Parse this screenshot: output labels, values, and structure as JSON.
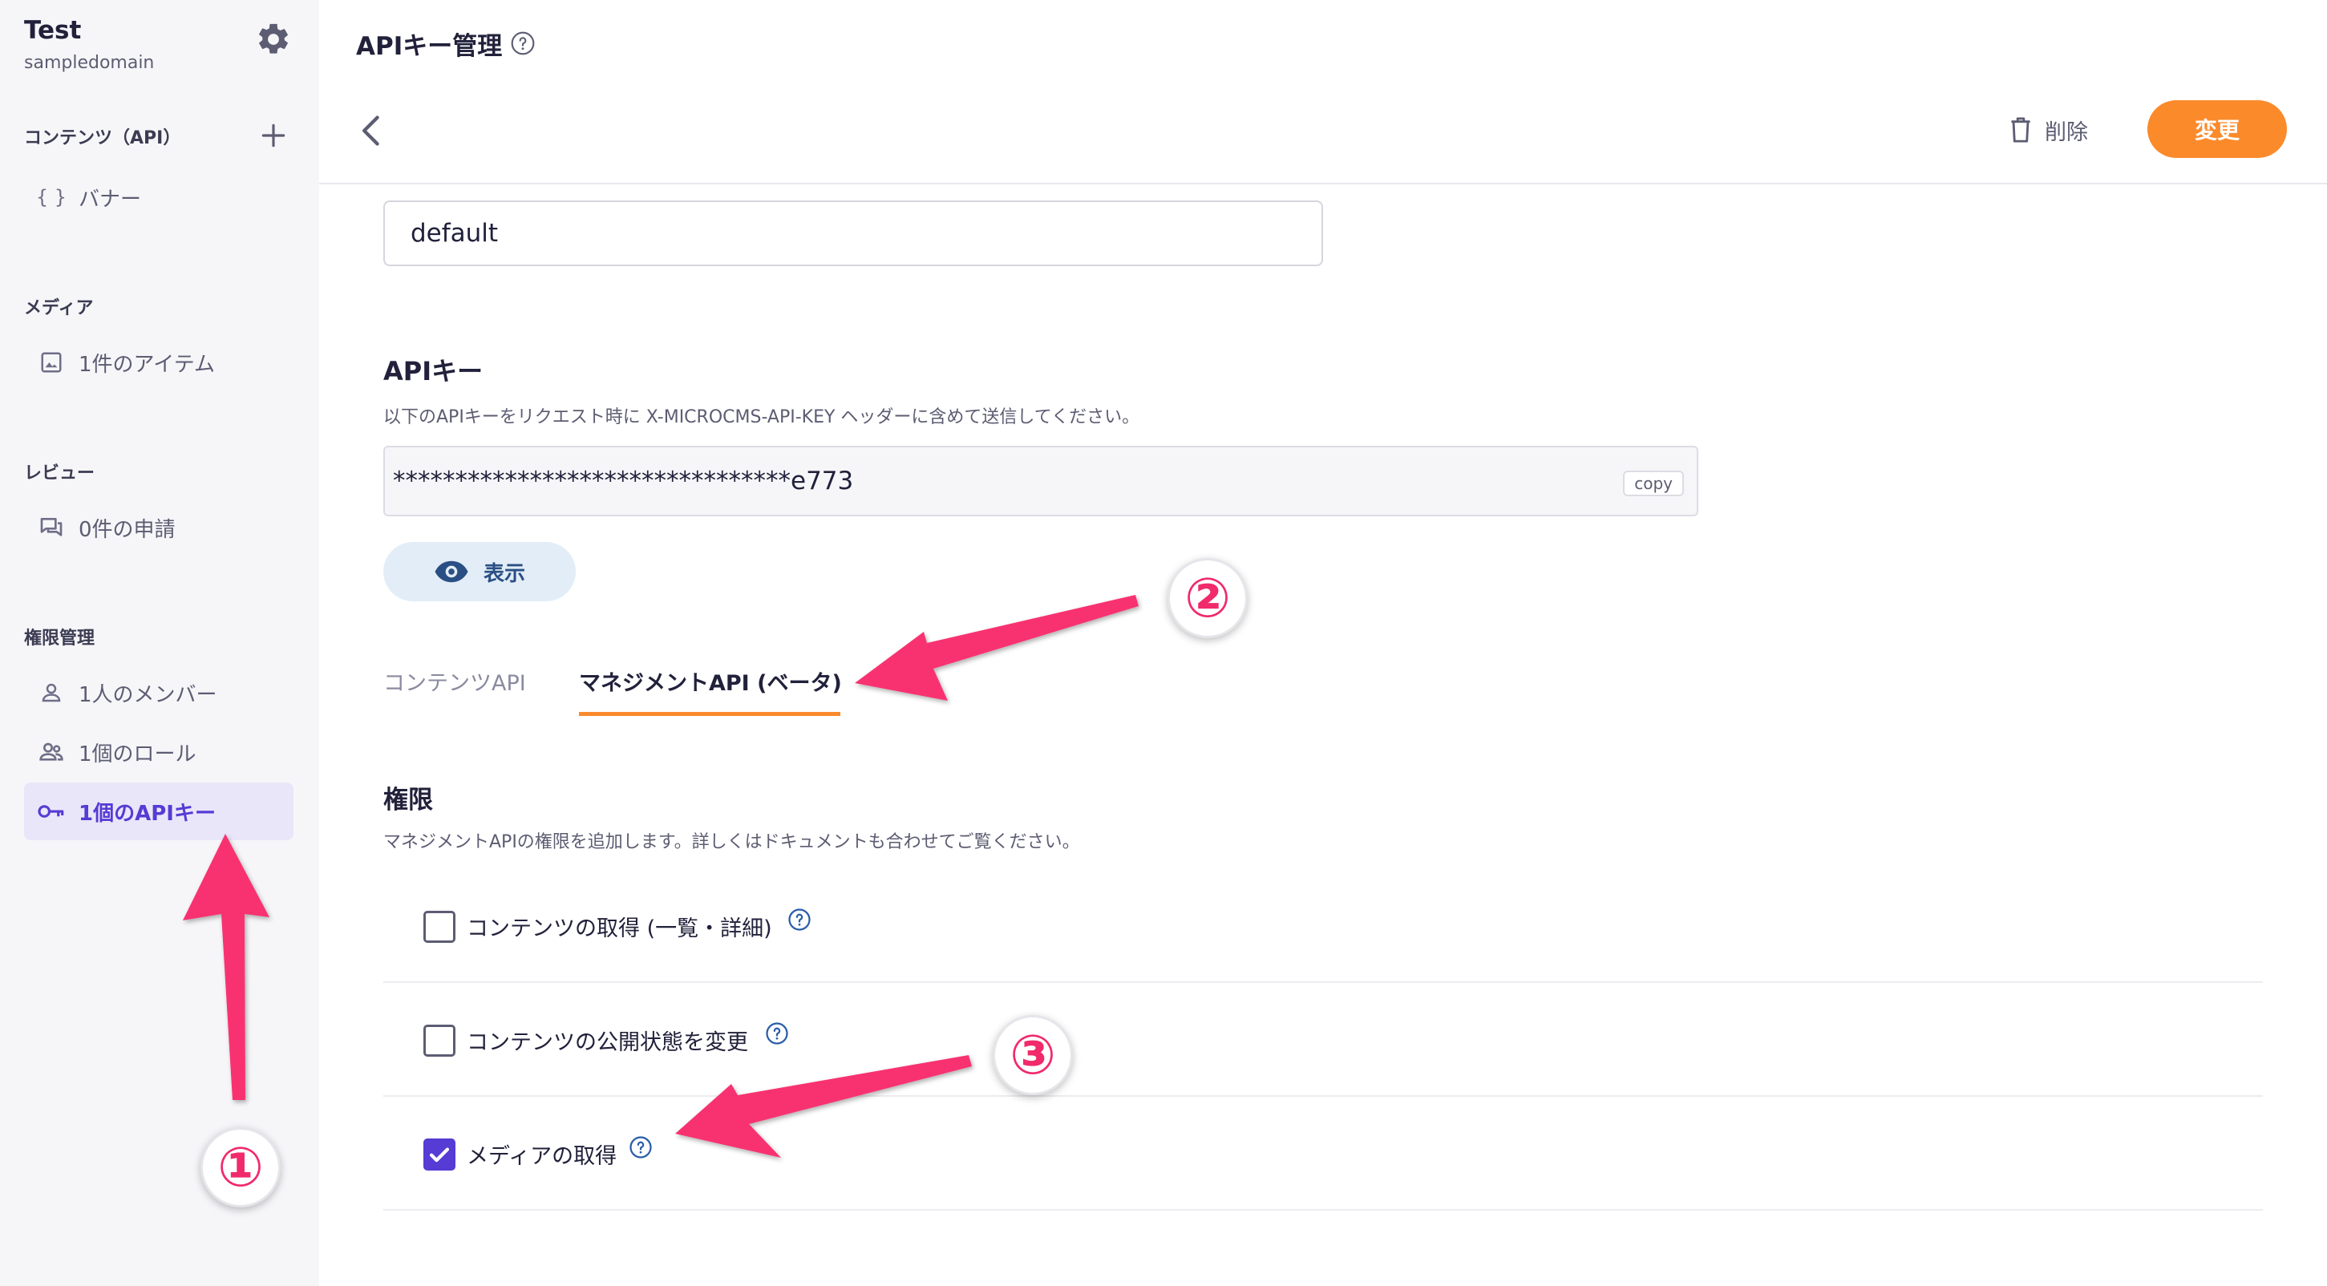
{
  "sidebar": {
    "service_name": "Test",
    "service_domain": "sampledomain",
    "sections": {
      "contents": "コンテンツ（API）",
      "media": "メディア",
      "review": "レビュー",
      "permissions": "権限管理"
    },
    "items": {
      "banner": "バナー",
      "media_items": "1件のアイテム",
      "review_requests": "0件の申請",
      "members": "1人のメンバー",
      "roles": "1個のロール",
      "api_keys": "1個のAPIキー"
    },
    "banner_icon_text": "{ }"
  },
  "header": {
    "title": "APIキー管理",
    "delete_label": "削除",
    "change_label": "変更"
  },
  "main": {
    "name_value": "default",
    "apikey_heading": "APIキー",
    "apikey_desc": "以下のAPIキーをリクエスト時に X-MICROCMS-API-KEY ヘッダーに含めて送信してください。",
    "apikey_masked": "********************************e773",
    "copy_label": "copy",
    "show_label": "表示",
    "tabs": {
      "content_api": "コンテンツAPI",
      "management_api": "マネジメントAPI (ベータ)"
    },
    "perm_heading": "権限",
    "perm_desc": "マネジメントAPIの権限を追加します。詳しくはドキュメントも合わせてご覧ください。",
    "permissions": [
      {
        "label": "コンテンツの取得 (一覧・詳細)",
        "checked": false
      },
      {
        "label": "コンテンツの公開状態を変更",
        "checked": false
      },
      {
        "label": "メディアの取得",
        "checked": true
      }
    ]
  },
  "annotations": {
    "one": "①",
    "two": "②",
    "three": "③"
  },
  "colors": {
    "accent": "#563bd4",
    "orange": "#fb8a2b",
    "arrow": "#f8306f"
  }
}
